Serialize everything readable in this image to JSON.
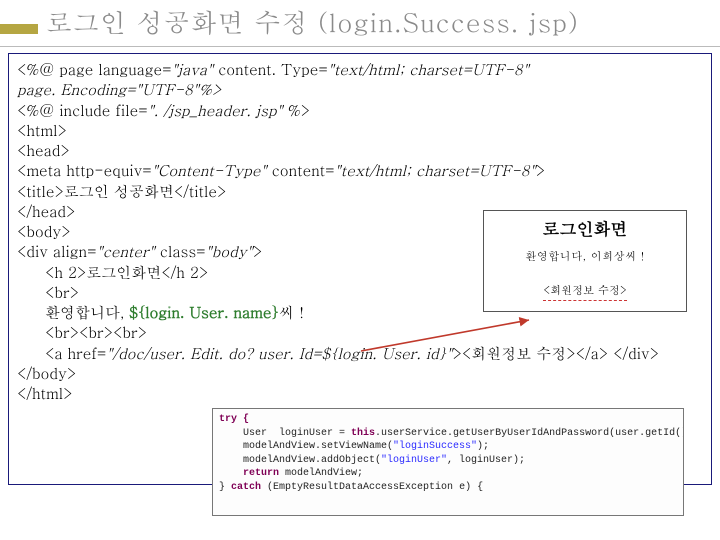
{
  "title": "로그인 성공화면 수정 (login.Success. jsp)",
  "code": {
    "l1a": "<%@ page language=",
    "l1b": "\"java\"",
    "l1c": " content. Type=",
    "l1d": "\"text/html; charset=UTF-8\"",
    "l2a": "page. Encoding=",
    "l2b": "\"UTF-8\"",
    "l2c": "%>",
    "l3a": "<%@ include file=",
    "l3b": "\". /jsp_header. jsp\" ",
    "l3c": "%>",
    "l4": "<html>",
    "l5": "<head>",
    "l6a": "<meta http-equiv=",
    "l6b": "\"Content-Type\"",
    "l6c": " content=",
    "l6d": "\"text/html; charset=UTF-8\"",
    "l6e": ">",
    "l7": "<title>로그인 성공화면</title>",
    "l8": "</head>",
    "l9": "<body>",
    "l10a": "<div align=",
    "l10b": "\"center\"",
    "l10c": " class=",
    "l10d": "\"body\"",
    "l10e": ">",
    "l11": "<h 2>로그인화면</h 2>",
    "l12": "<br>",
    "l13a": "환영합니다, ",
    "l13b": "${login. User. name}",
    "l13c": "씨！",
    "l14": "<br><br><br>",
    "l15a": "<a href=",
    "l15b": "\"/doc/user. Edit. do? user. Id=${login. User. id}\"",
    "l15c": "><회원정보 수정></a> </div>",
    "l16": "</body>",
    "l17": "</html>"
  },
  "preview": {
    "title": "로그인화면",
    "msg": "환영합니다, 이희상씨 !",
    "link": "<회원정보 수정>"
  },
  "java": {
    "j1": "try {",
    "j2a": "    User  loginUser = ",
    "j2b": "this",
    "j2c": ".userService.getUserByUserIdAndPassword(user.getId(), user.getPass());",
    "j3": "",
    "j4a": "    modelAndView.setViewName(",
    "j4b": "\"loginSuccess\"",
    "j4c": ");",
    "j5a": "    modelAndView.addObject(",
    "j5b": "\"loginUser\"",
    "j5c": ", loginUser);",
    "j6a": "    ",
    "j6b": "return",
    "j6c": " modelAndView;",
    "j7a": "} ",
    "j7b": "catch",
    "j7c": " (EmptyResultDataAccessException e) {"
  }
}
